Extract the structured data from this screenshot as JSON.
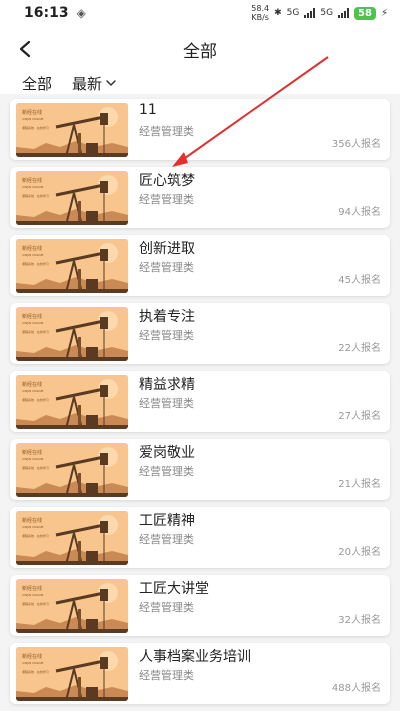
{
  "status": {
    "time": "16:13",
    "speed_value": "58.4",
    "speed_unit": "KB/s",
    "net1": "5G",
    "net2": "5G",
    "battery": "58"
  },
  "header": {
    "back_icon": "chevron-left-icon",
    "title": "全部"
  },
  "filters": {
    "all_label": "全部",
    "sort_label": "最新"
  },
  "colors": {
    "accent_arrow": "#e03030",
    "thumb_bg": "#f7c58d",
    "thumb_dark": "#5a3a20",
    "battery": "#4cc34c"
  },
  "thumb_text": {
    "line1": "新经在线",
    "line2": "XINJIN ONLINE",
    "line3": "课程系统 · 在线学习"
  },
  "courses": [
    {
      "title": "11",
      "category": "经营管理类",
      "count": "356人报名"
    },
    {
      "title": "匠心筑梦",
      "category": "经营管理类",
      "count": "94人报名"
    },
    {
      "title": "创新进取",
      "category": "经营管理类",
      "count": "45人报名"
    },
    {
      "title": "执着专注",
      "category": "经营管理类",
      "count": "22人报名"
    },
    {
      "title": "精益求精",
      "category": "经营管理类",
      "count": "27人报名"
    },
    {
      "title": "爱岗敬业",
      "category": "经营管理类",
      "count": "21人报名"
    },
    {
      "title": "工匠精神",
      "category": "经营管理类",
      "count": "20人报名"
    },
    {
      "title": "工匠大讲堂",
      "category": "经营管理类",
      "count": "32人报名"
    },
    {
      "title": "人事档案业务培训",
      "category": "经营管理类",
      "count": "488人报名"
    }
  ]
}
